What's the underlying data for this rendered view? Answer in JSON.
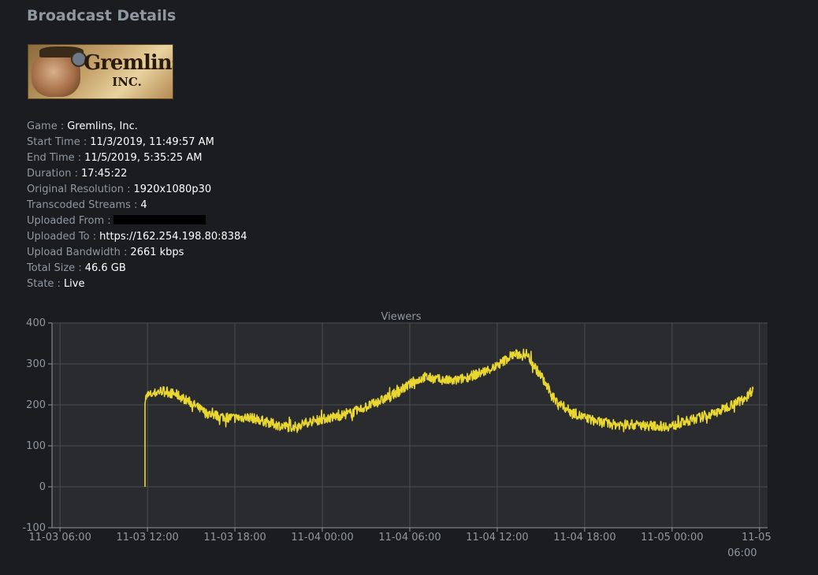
{
  "page": {
    "title": "Broadcast Details"
  },
  "logo": {
    "line1": "Gremlins",
    "line2": "INC."
  },
  "details": [
    {
      "key": "Game",
      "value": "Gremlins, Inc."
    },
    {
      "key": "Start Time",
      "value": "11/3/2019, 11:49:57 AM"
    },
    {
      "key": "End Time",
      "value": "11/5/2019, 5:35:25 AM"
    },
    {
      "key": "Duration",
      "value": "17:45:22"
    },
    {
      "key": "Original Resolution",
      "value": "1920x1080p30"
    },
    {
      "key": "Transcoded Streams",
      "value": "4"
    },
    {
      "key": "Uploaded From",
      "value": ""
    },
    {
      "key": "Uploaded To",
      "value": "https://162.254.198.80:8384"
    },
    {
      "key": "Upload Bandwidth",
      "value": "2661 kbps"
    },
    {
      "key": "Total Size",
      "value": "46.6 GB"
    },
    {
      "key": "State",
      "value": "Live"
    }
  ],
  "chart_data": {
    "type": "line",
    "title": "Viewers",
    "xlabel": "",
    "ylabel": "",
    "ylim": [
      -100,
      400
    ],
    "yticks": [
      -100,
      0,
      100,
      200,
      300,
      400
    ],
    "xlim_hours": [
      0,
      48
    ],
    "xticks": [
      "11-03 06:00",
      "11-03 12:00",
      "11-03 18:00",
      "11-04 00:00",
      "11-04 06:00",
      "11-04 12:00",
      "11-04 18:00",
      "11-05 00:00",
      "11-05 06:00"
    ],
    "grid": true,
    "colors": {
      "line": "#e9d730",
      "plot_bg": "#2a2b2f",
      "grid": "#4a4c52",
      "axis": "#8f98a0"
    },
    "series": [
      {
        "x": [
          "11-03 11:50",
          "11-03 11:50",
          "11-03 12:00",
          "11-03 13:00",
          "11-03 14:00",
          "11-03 15:00",
          "11-03 16:00",
          "11-03 17:00",
          "11-03 18:00",
          "11-03 19:00",
          "11-03 20:00",
          "11-03 21:00",
          "11-03 22:00",
          "11-03 23:00",
          "11-04 00:00",
          "11-04 01:00",
          "11-04 02:00",
          "11-04 03:00",
          "11-04 04:00",
          "11-04 05:00",
          "11-04 06:00",
          "11-04 07:00",
          "11-04 08:00",
          "11-04 09:00",
          "11-04 10:00",
          "11-04 11:00",
          "11-04 12:00",
          "11-04 13:00",
          "11-04 14:00",
          "11-04 15:00",
          "11-04 16:00",
          "11-04 17:00",
          "11-04 18:00",
          "11-04 19:00",
          "11-04 20:00",
          "11-04 21:00",
          "11-04 22:00",
          "11-04 23:00",
          "11-05 00:00",
          "11-05 01:00",
          "11-05 02:00",
          "11-05 03:00",
          "11-05 04:00",
          "11-05 05:00",
          "11-05 05:35"
        ],
        "values": [
          0,
          215,
          222,
          235,
          225,
          205,
          180,
          172,
          168,
          170,
          160,
          150,
          145,
          158,
          165,
          172,
          180,
          195,
          210,
          228,
          250,
          268,
          262,
          258,
          268,
          280,
          295,
          322,
          325,
          270,
          210,
          185,
          168,
          158,
          152,
          152,
          150,
          148,
          148,
          160,
          170,
          180,
          200,
          215,
          240
        ]
      }
    ]
  }
}
